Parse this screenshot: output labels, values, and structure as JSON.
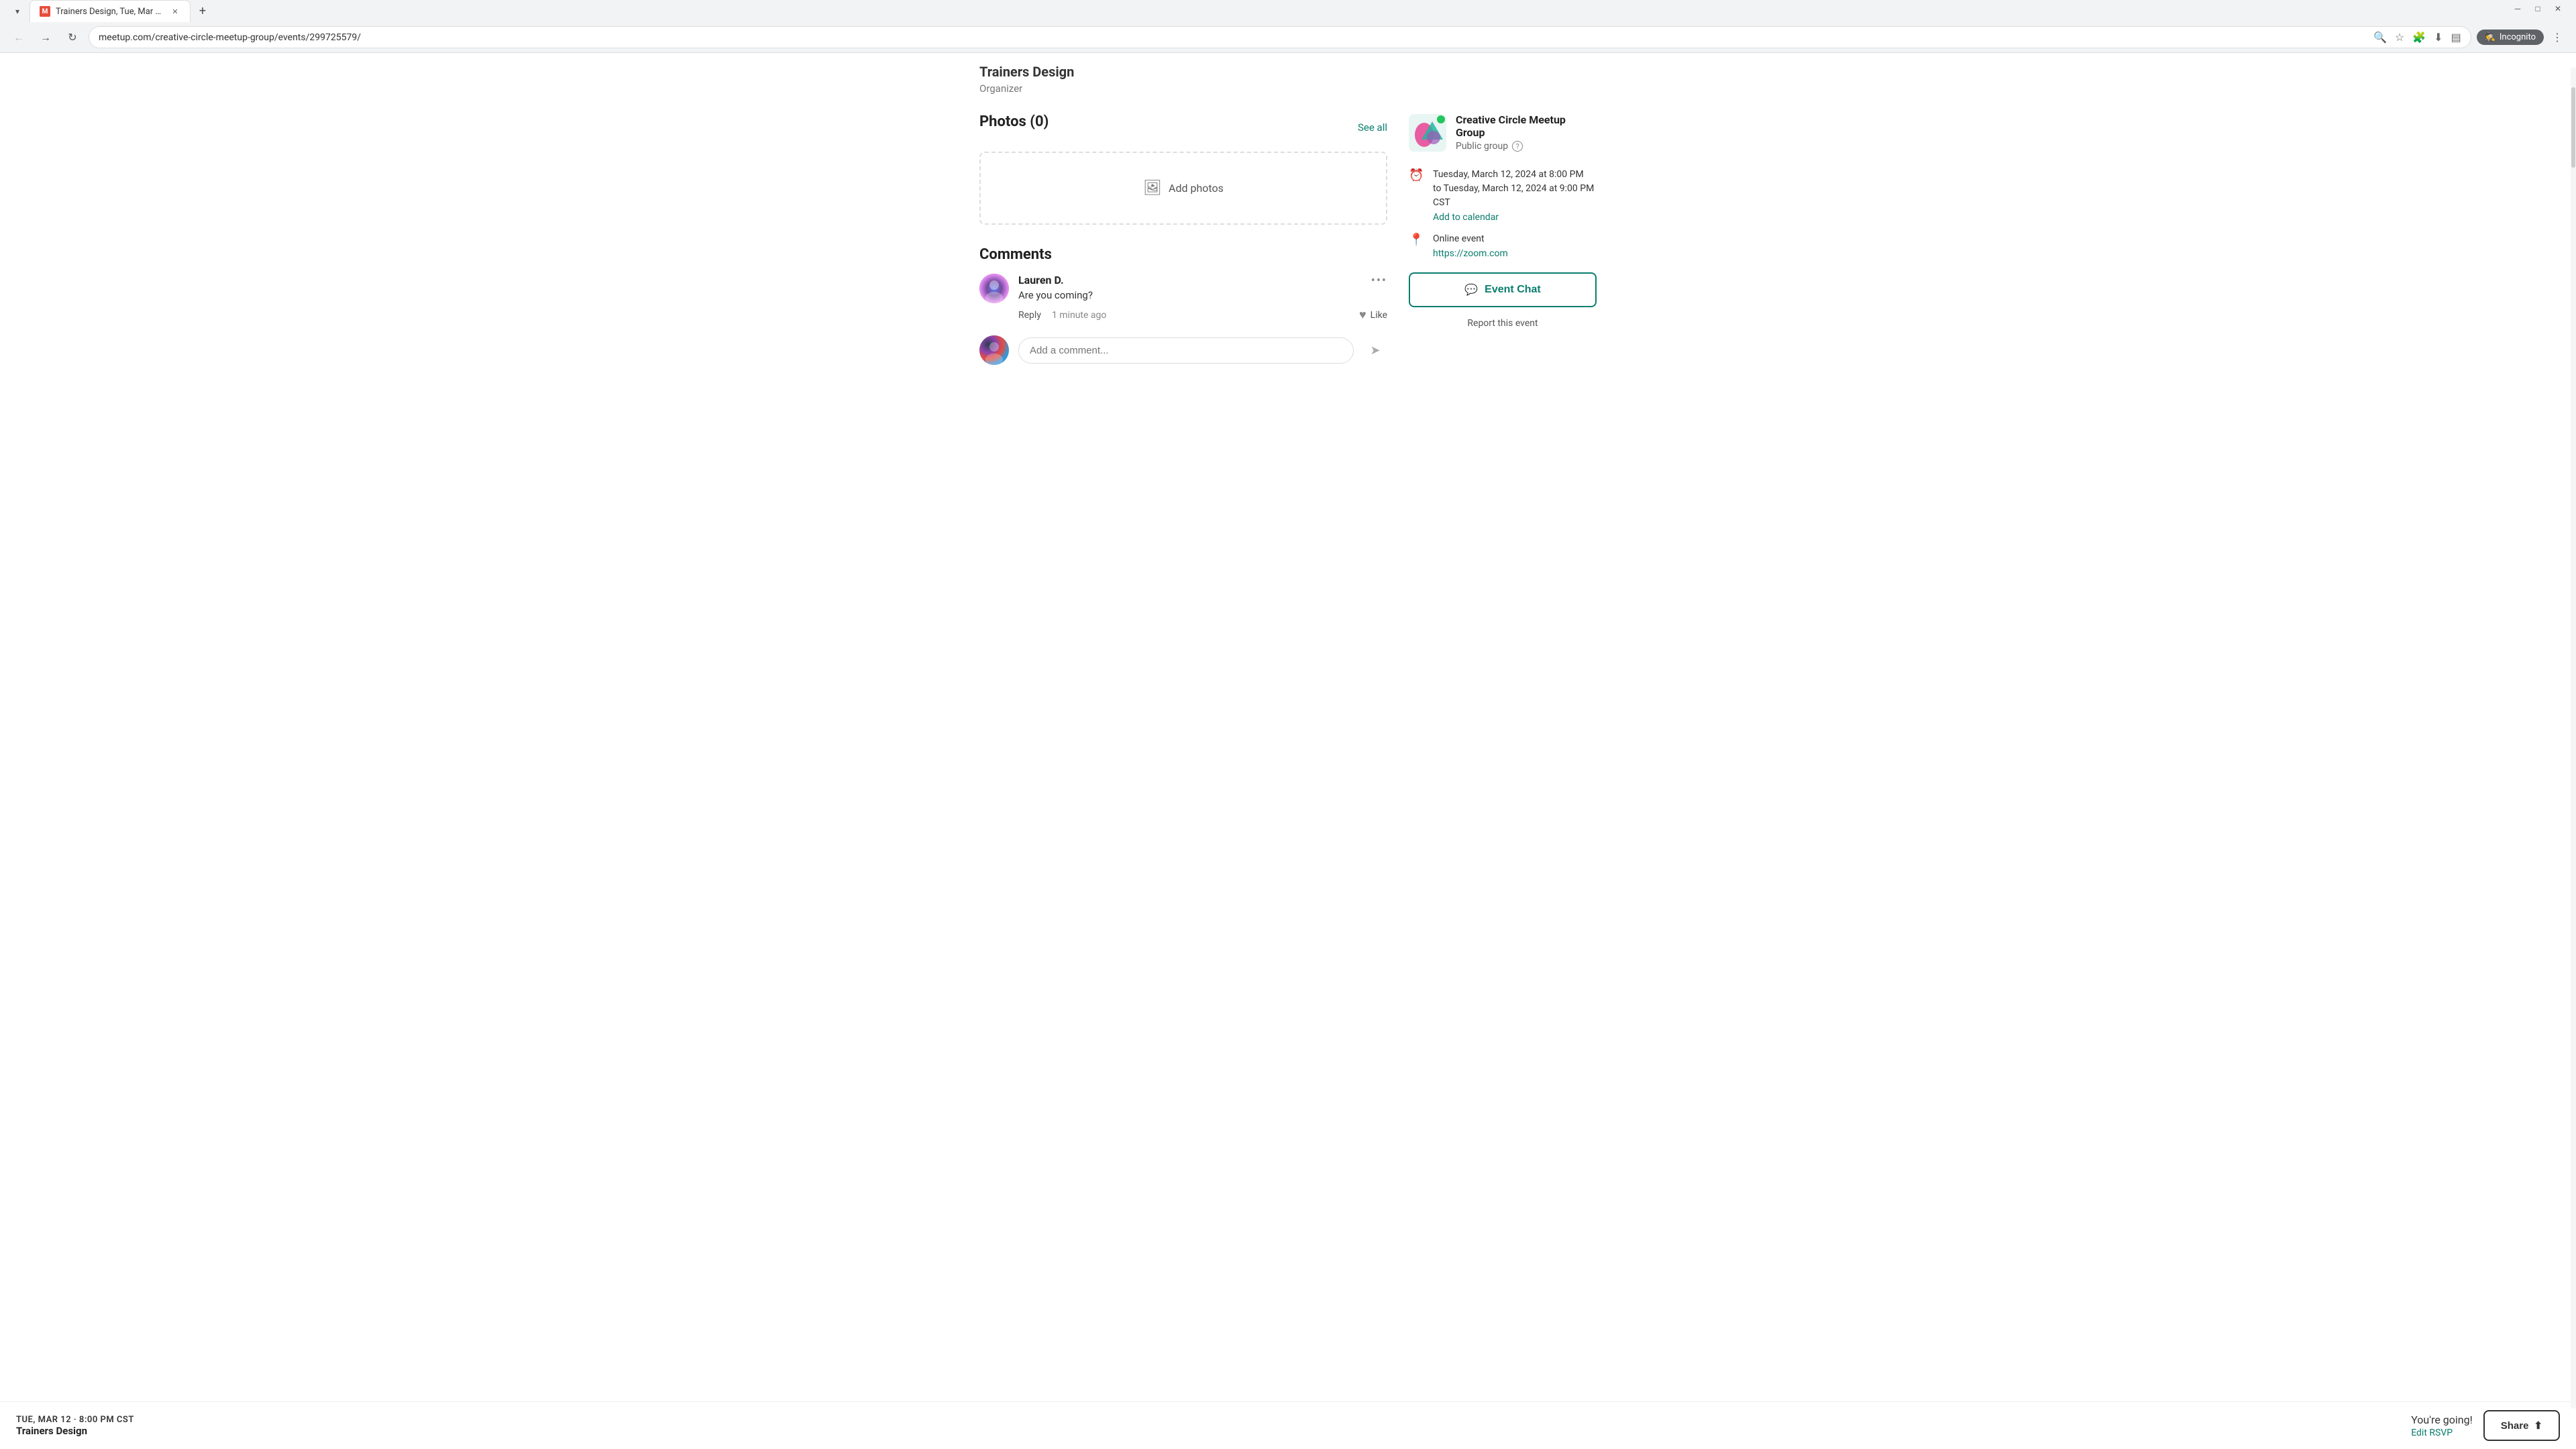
{
  "browser": {
    "tab_title": "Trainers Design, Tue, Mar 12, 2...",
    "tab_favicon": "M",
    "url": "meetup.com/creative-circle-meetup-group/events/299725579/",
    "incognito_label": "Incognito"
  },
  "page": {
    "organizer_name": "Trainers Design",
    "organizer_label": "Organizer",
    "photos_title": "Photos (0)",
    "see_all_label": "See all",
    "add_photos_label": "Add photos",
    "comments_title": "Comments"
  },
  "comment": {
    "author": "Lauren D.",
    "text": "Are you coming?",
    "reply_label": "Reply",
    "timestamp": "1 minute ago",
    "like_label": "Like",
    "more_dots": "•••"
  },
  "comment_input": {
    "placeholder": "Add a comment..."
  },
  "sidebar": {
    "group_name": "Creative Circle Meetup Group",
    "group_type": "Public group",
    "online_indicator": true,
    "event_date": "Tuesday, March 12, 2024 at 8:00 PM",
    "event_date_to": "to Tuesday, March 12, 2024 at 9:00 PM CST",
    "add_to_calendar_label": "Add to calendar",
    "location_type": "Online event",
    "zoom_link": "https://zoom.com",
    "event_chat_label": "Event Chat",
    "report_label": "Report this event"
  },
  "footer": {
    "date": "TUE, MAR 12 · 8:00 PM CST",
    "event_name": "Trainers Design",
    "going_text": "You're going!",
    "edit_rsvp_label": "Edit RSVP",
    "share_label": "Share"
  }
}
